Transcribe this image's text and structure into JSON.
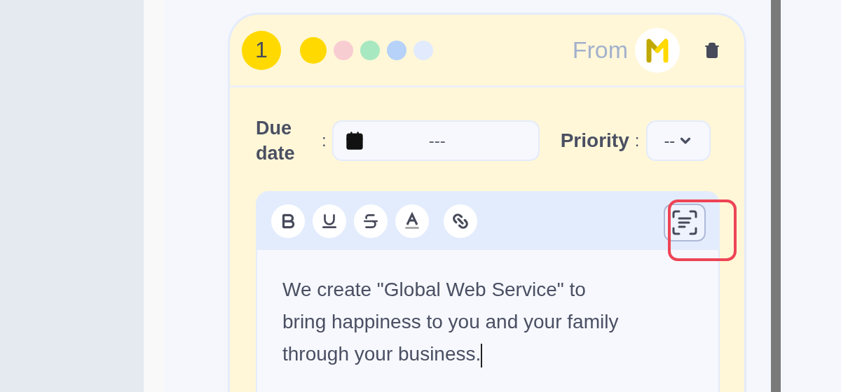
{
  "card": {
    "number": "1",
    "colors": [
      {
        "color": "#ffd900",
        "selected": true
      },
      {
        "color": "#f8cdd2",
        "selected": false
      },
      {
        "color": "#a8e8c0",
        "selected": false
      },
      {
        "color": "#b6d2f8",
        "selected": false
      },
      {
        "color": "#e2ebfd",
        "selected": false
      }
    ],
    "from_label": "From",
    "due_date": {
      "label": "Due date",
      "separator": ":",
      "value": "---"
    },
    "priority": {
      "label": "Priority",
      "separator": ":",
      "value": "--"
    },
    "toolbar": [
      {
        "kind": "bold"
      },
      {
        "kind": "underline"
      },
      {
        "kind": "strike"
      },
      {
        "kind": "color"
      },
      {
        "kind": "link"
      }
    ],
    "scan_button": {
      "highlighted": true
    },
    "editor_text": "We create \"Global Web Service\" to bring happiness to you and your family through your business."
  }
}
